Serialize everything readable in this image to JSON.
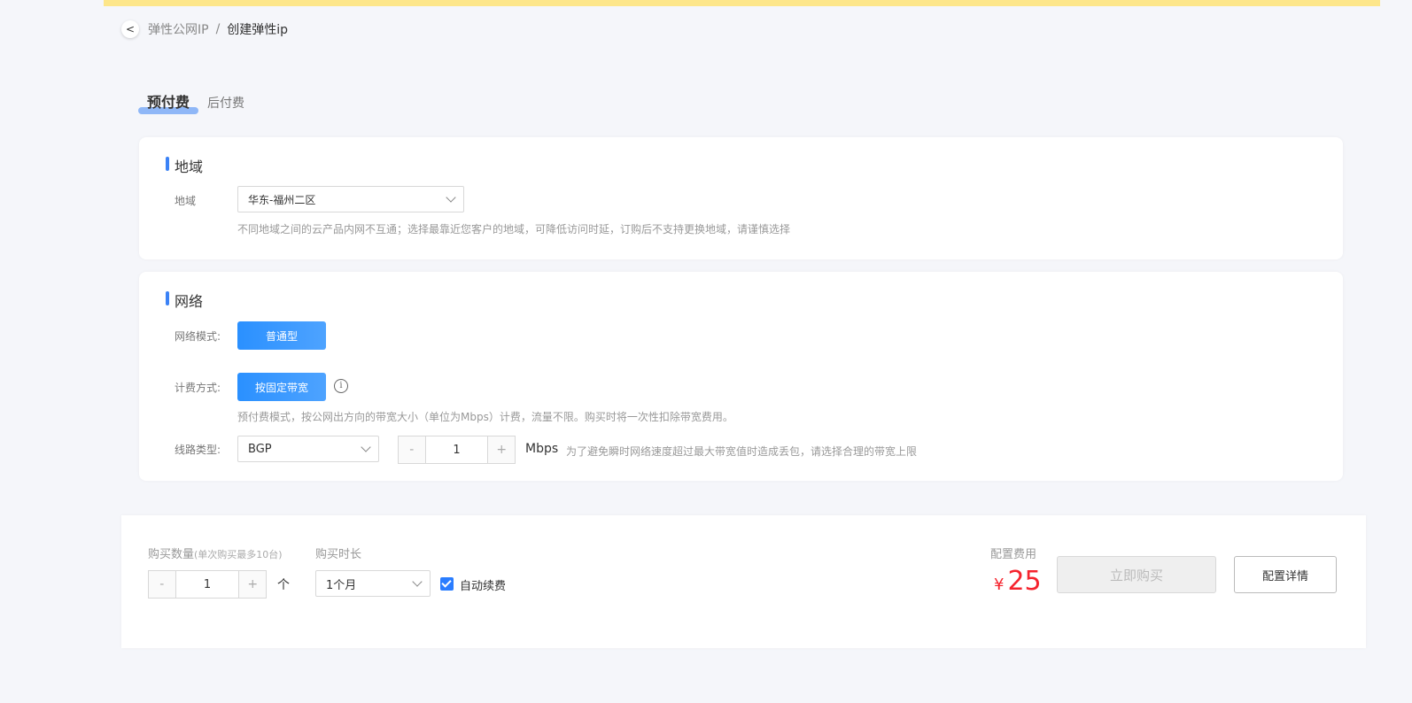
{
  "breadcrumb": {
    "back_icon": "<",
    "parent": "弹性公网IP",
    "separator": "/",
    "current": "创建弹性ip"
  },
  "tabs": [
    {
      "label": "预付费",
      "active": true
    },
    {
      "label": "后付费",
      "active": false
    }
  ],
  "region_card": {
    "title": "地域",
    "label": "地域",
    "selected": "华东-福州二区",
    "hint": "不同地域之间的云产品内网不互通；选择最靠近您客户的地域，可降低访问时延，订购后不支持更换地域，请谨慎选择"
  },
  "network_card": {
    "title": "网络",
    "mode_label": "网络模式:",
    "mode_value": "普通型",
    "billing_label": "计费方式:",
    "billing_value": "按固定带宽",
    "billing_info_icon": "i",
    "billing_hint": "预付费模式，按公网出方向的带宽大小（单位为Mbps）计费，流量不限。购买时将一次性扣除带宽费用。",
    "line_label": "线路类型:",
    "line_value": "BGP",
    "bandwidth": {
      "minus": "-",
      "value": "1",
      "plus": "+",
      "unit": "Mbps"
    },
    "bandwidth_hint": "为了避免瞬时网络速度超过最大带宽值时造成丢包，请选择合理的带宽上限"
  },
  "footer": {
    "quantity_label": "购买数量",
    "quantity_sub": "(单次购买最多10台)",
    "quantity": {
      "minus": "-",
      "value": "1",
      "plus": "+",
      "unit": "个"
    },
    "duration_label": "购买时长",
    "duration_value": "1个月",
    "auto_renew_label": "自动续费",
    "auto_renew_checked": true,
    "fee_label": "配置费用",
    "currency": "¥",
    "price": "25",
    "buy_label": "立即购买",
    "detail_label": "配置详情"
  },
  "colors": {
    "accent": "#2a90ff",
    "price": "#f5232d",
    "banner": "#fde68a"
  }
}
